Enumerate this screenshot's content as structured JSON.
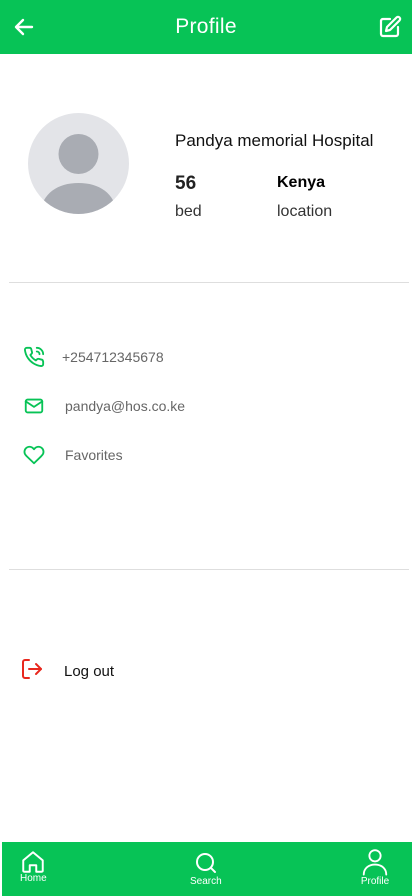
{
  "header": {
    "title": "Profile",
    "back_icon": "arrow-left-icon",
    "edit_icon": "edit-icon",
    "color": "#07c356"
  },
  "profile": {
    "name": "Pandya memorial Hospital",
    "beds_value": "56",
    "beds_label": "bed",
    "location_value": "Kenya",
    "location_label": "location"
  },
  "contacts": [
    {
      "icon": "phone-icon",
      "text": "+254712345678"
    },
    {
      "icon": "mail-icon",
      "text": "pandya@hos.co.ke"
    },
    {
      "icon": "heart-icon",
      "text": "Favorites"
    }
  ],
  "logout": {
    "icon": "logout-icon",
    "label": "Log out",
    "color": "#e8281e"
  },
  "bottom_nav": [
    {
      "icon": "home-icon",
      "label": "Home"
    },
    {
      "icon": "search-icon",
      "label": "Search"
    },
    {
      "icon": "user-icon",
      "label": "Profile"
    }
  ]
}
